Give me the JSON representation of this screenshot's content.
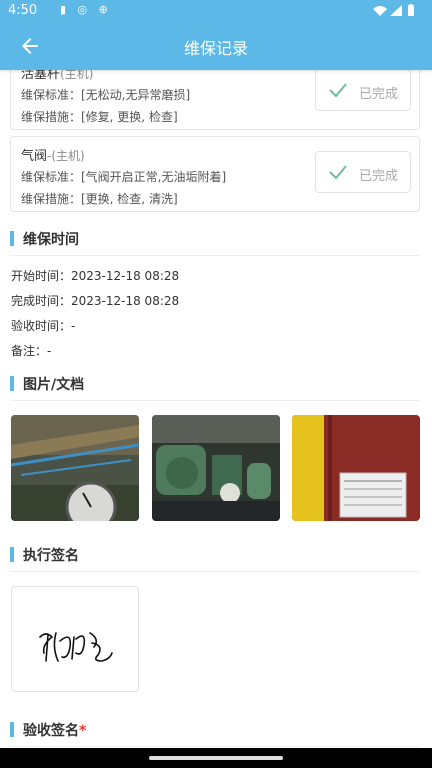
{
  "status_bar": {
    "time": "4:50"
  },
  "app_bar": {
    "title": "维保记录"
  },
  "items": [
    {
      "name": "活塞杆",
      "sub": "(主机)",
      "standard": "维保标准：[无松动,无异常磨损]",
      "measures": "维保措施：[修复, 更换, 检查]",
      "status": "已完成"
    },
    {
      "name": "气阀",
      "sub": "-(主机)",
      "standard": "维保标准：[气阀开启正常,无油垢附着]",
      "measures": "维保措施：[更换, 检查, 清洗]",
      "status": "已完成"
    }
  ],
  "time_section": {
    "title": "维保时间",
    "start": "开始时间：2023-12-18 08:28",
    "finish": "完成时间：2023-12-18 08:28",
    "accept": "验收时间：-",
    "note": "备注：-"
  },
  "media_section": {
    "title": "图片/文档"
  },
  "exec_signature": {
    "title": "执行签名"
  },
  "accept_signature": {
    "title": "验收签名",
    "required_mark": "*"
  },
  "colors": {
    "primary": "#5cb8e6",
    "done_check": "#6cbf9b",
    "required": "#e53935"
  },
  "icons": [
    "arrow-left-icon",
    "check-icon",
    "wifi-icon",
    "signal-icon",
    "battery-icon"
  ]
}
